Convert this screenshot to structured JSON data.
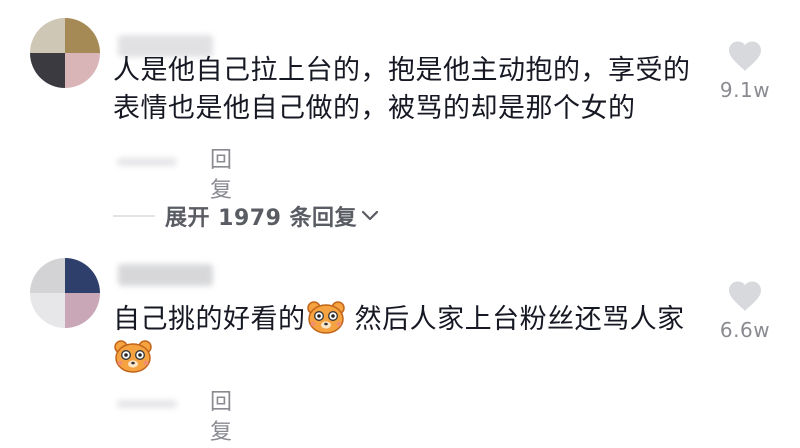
{
  "comments": [
    {
      "username": "",
      "text": "人是他自己拉上台的，抱是他主动抱的，享受的表情也是他自己做的，被骂的却是那个女的",
      "like_count": "9.1w",
      "reply_label": "回复",
      "expand_label": "展开 1979 条回复"
    },
    {
      "username": "",
      "text_part1": "自己挑的好看的",
      "text_part2": " 然后人家上台粉丝还骂人家",
      "emoji": "bear-face-emoji",
      "like_count": "6.6w",
      "reply_label": "回复"
    }
  ],
  "icons": {
    "like": "heart-icon",
    "expand": "chevron-down-icon"
  },
  "colors": {
    "text_primary": "#161823",
    "text_secondary": "#8a8b91",
    "heart": "#d8d9dc",
    "emoji_face": "#f4a340"
  }
}
